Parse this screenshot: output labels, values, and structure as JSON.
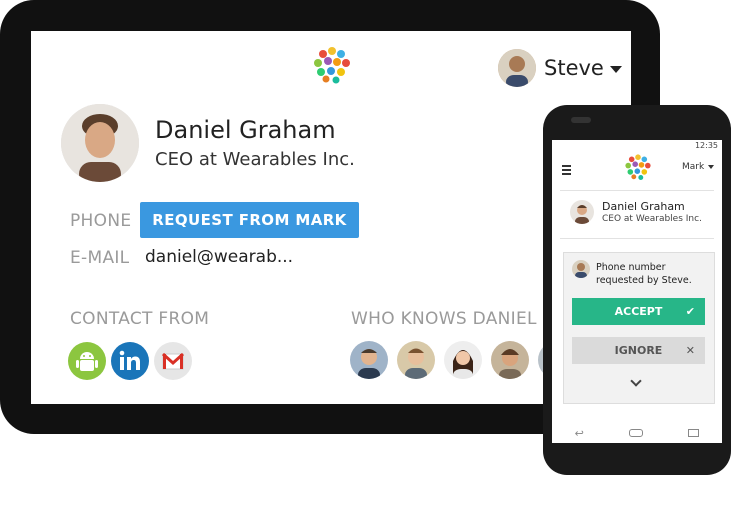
{
  "header": {
    "user_name": "Steve"
  },
  "contact": {
    "name": "Daniel Graham",
    "title": "CEO at Wearables Inc.",
    "phone_label": "PHONE",
    "request_button": "REQUEST FROM MARK",
    "email_label": "E-MAIL",
    "email_value": "daniel@wearab...",
    "contact_from_label": "CONTACT FROM",
    "who_knows_label": "WHO KNOWS DANIEL",
    "sources": [
      "android-icon",
      "linkedin-icon",
      "gmail-icon"
    ]
  },
  "phone": {
    "status_time": "12:35",
    "menu_user": "Mark",
    "contact_name": "Daniel Graham",
    "contact_title": "CEO at Wearables Inc.",
    "notification": "Phone number requested by Steve.",
    "accept_label": "ACCEPT",
    "ignore_label": "IGNORE"
  },
  "colors": {
    "accent_blue": "#3a98e0",
    "accept_green": "#27b688",
    "label_gray": "#9a9a9a"
  }
}
